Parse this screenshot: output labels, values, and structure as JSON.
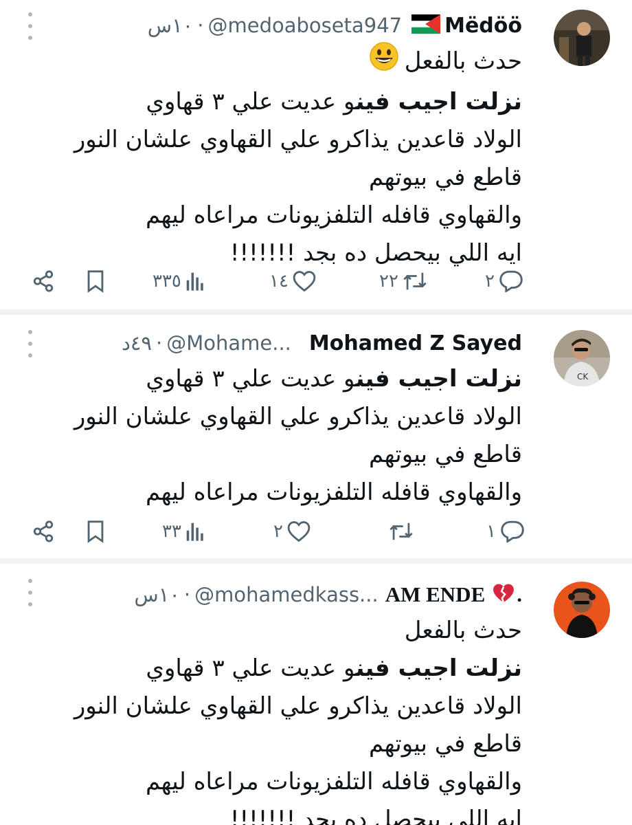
{
  "tweets": [
    {
      "name": "Mëdöö",
      "handle": "@medoaboseta947",
      "dot": "·",
      "time": "١٠س",
      "lines": [
        {
          "pre": "حدث بالفعل",
          "bold1": "",
          "mid": "",
          "bold2": "",
          "post": ""
        },
        {
          "pre": "",
          "bold1": "نزلت اجيب فين",
          "mid": "و عديت علي ٣ قهاوي",
          "bold2": "",
          "post": ""
        },
        {
          "pre": "الولاد قاعدين يذاكرو علي القهاوي علشان النور",
          "bold1": "",
          "mid": "",
          "bold2": "",
          "post": ""
        },
        {
          "pre": "قاطع في بيوتهم",
          "bold1": "",
          "mid": "",
          "bold2": "",
          "post": ""
        },
        {
          "pre": "والقهاوي قافله التلفزيونات مراعاه ليهم",
          "bold1": "",
          "mid": "",
          "bold2": "",
          "post": ""
        },
        {
          "pre": "ايه اللي بيحصل ده بجد !!!!!!!",
          "bold1": "",
          "mid": "",
          "bold2": "",
          "post": ""
        }
      ],
      "replies": "٢",
      "retweets": "٢٢",
      "likes": "١٤",
      "views": "٣٣٥"
    },
    {
      "name": "Mohamed Z Sayed",
      "handle": "@Mohame...",
      "dot": "·",
      "time": "٤٩د",
      "lines": [
        {
          "pre": "",
          "bold1": "نزلت اجيب فين",
          "mid": "و عديت علي ٣ قهاوي",
          "bold2": "",
          "post": ""
        },
        {
          "pre": "الولاد قاعدين يذاكرو علي القهاوي علشان النور",
          "bold1": "",
          "mid": "",
          "bold2": "",
          "post": ""
        },
        {
          "pre": "قاطع في بيوتهم",
          "bold1": "",
          "mid": "",
          "bold2": "",
          "post": ""
        },
        {
          "pre": "والقهاوي قافله التلفزيونات مراعاه ليهم",
          "bold1": "",
          "mid": "",
          "bold2": "",
          "post": ""
        }
      ],
      "replies": "١",
      "retweets": "",
      "likes": "٢",
      "views": "٣٣"
    },
    {
      "name": "AM ENDE",
      "name_suffix": ".",
      "handle": "@mohamedkass...",
      "dot": "·",
      "time": "١٠س",
      "lines": [
        {
          "pre": "حدث بالفعل",
          "bold1": "",
          "mid": "",
          "bold2": "",
          "post": ""
        },
        {
          "pre": "",
          "bold1": "نزلت اجيب فين",
          "mid": "و عديت علي ٣ قهاوي",
          "bold2": "",
          "post": ""
        },
        {
          "pre": "الولاد قاعدين يذاكرو علي القهاوي علشان النور",
          "bold1": "",
          "mid": "",
          "bold2": "",
          "post": ""
        },
        {
          "pre": "قاطع في بيوتهم",
          "bold1": "",
          "mid": "",
          "bold2": "",
          "post": ""
        },
        {
          "pre": "والقهاوي قافله التلفزيونات مراعاه ليهم",
          "bold1": "",
          "mid": "",
          "bold2": "",
          "post": ""
        },
        {
          "pre": "ايه اللي بيحصل ده بجد !!!!!!!",
          "bold1": "",
          "mid": "",
          "bold2": "",
          "post": ""
        }
      ]
    }
  ],
  "icons": {
    "reply": "reply-icon",
    "retweet": "retweet-icon",
    "like": "heart-icon",
    "views": "views-icon",
    "bookmark": "bookmark-icon",
    "share": "share-icon",
    "more": "more-icon",
    "flag": "palestine-flag-icon",
    "emoji": "grinning-face-icon",
    "broken_heart": "broken-heart-icon"
  },
  "colors": {
    "text": "#0f1419",
    "secondary": "#536471",
    "divider": "#eff3f4",
    "emoji": "#f7c325",
    "broken_heart": "#d7263d"
  }
}
